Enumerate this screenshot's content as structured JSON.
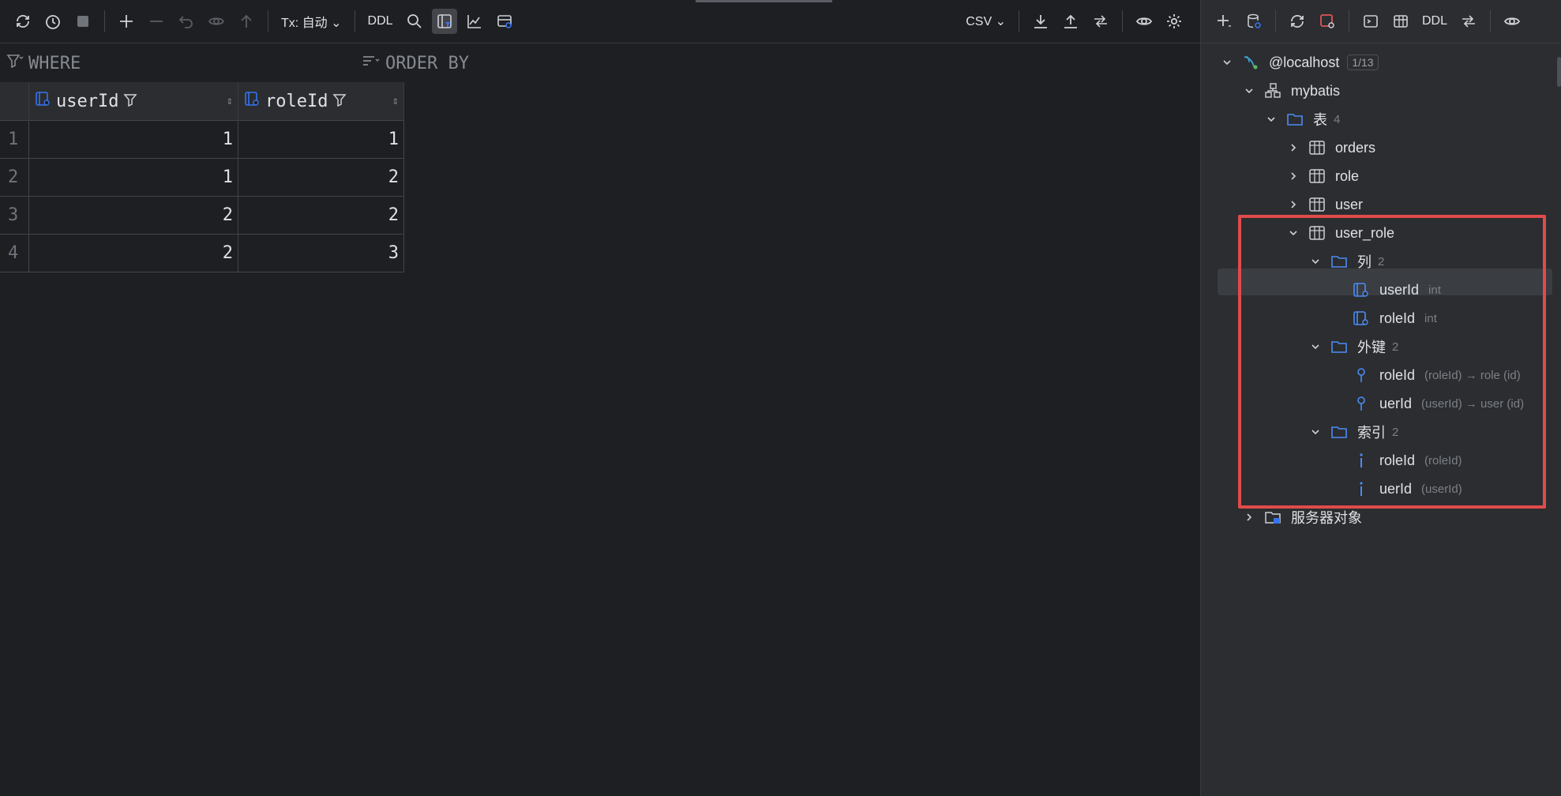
{
  "toolbar_left": {
    "tx_label": "Tx: 自动",
    "ddl_label": "DDL",
    "csv_label": "CSV"
  },
  "filters": {
    "where_label": "WHERE",
    "orderby_label": "ORDER BY"
  },
  "grid": {
    "columns": [
      "userId",
      "roleId"
    ],
    "rows": [
      {
        "num": "1",
        "userId": "1",
        "roleId": "1"
      },
      {
        "num": "2",
        "userId": "1",
        "roleId": "2"
      },
      {
        "num": "3",
        "userId": "2",
        "roleId": "2"
      },
      {
        "num": "4",
        "userId": "2",
        "roleId": "3"
      }
    ]
  },
  "toolbar_right": {
    "ddl_label": "DDL"
  },
  "tree": {
    "host": {
      "label": "@localhost",
      "badge": "1/13"
    },
    "schema": {
      "label": "mybatis"
    },
    "tables_folder": {
      "label": "表",
      "count": "4"
    },
    "tables": [
      {
        "label": "orders"
      },
      {
        "label": "role"
      },
      {
        "label": "user"
      },
      {
        "label": "user_role"
      }
    ],
    "columns_folder": {
      "label": "列",
      "count": "2"
    },
    "columns": [
      {
        "label": "userId",
        "type": "int"
      },
      {
        "label": "roleId",
        "type": "int"
      }
    ],
    "fk_folder": {
      "label": "外键",
      "count": "2"
    },
    "foreign_keys": [
      {
        "label": "roleId",
        "detail": "(roleId) → role (id)"
      },
      {
        "label": "uerId",
        "detail": "(userId) → user (id)"
      }
    ],
    "idx_folder": {
      "label": "索引",
      "count": "2"
    },
    "indexes": [
      {
        "label": "roleId",
        "detail": "(roleId)"
      },
      {
        "label": "uerId",
        "detail": "(userId)"
      }
    ],
    "server_objects": {
      "label": "服务器对象"
    }
  },
  "colors": {
    "accent": "#3574f0",
    "highlight_box": "#e04b4b",
    "background": "#1e1f22",
    "panel": "#2b2d30"
  }
}
